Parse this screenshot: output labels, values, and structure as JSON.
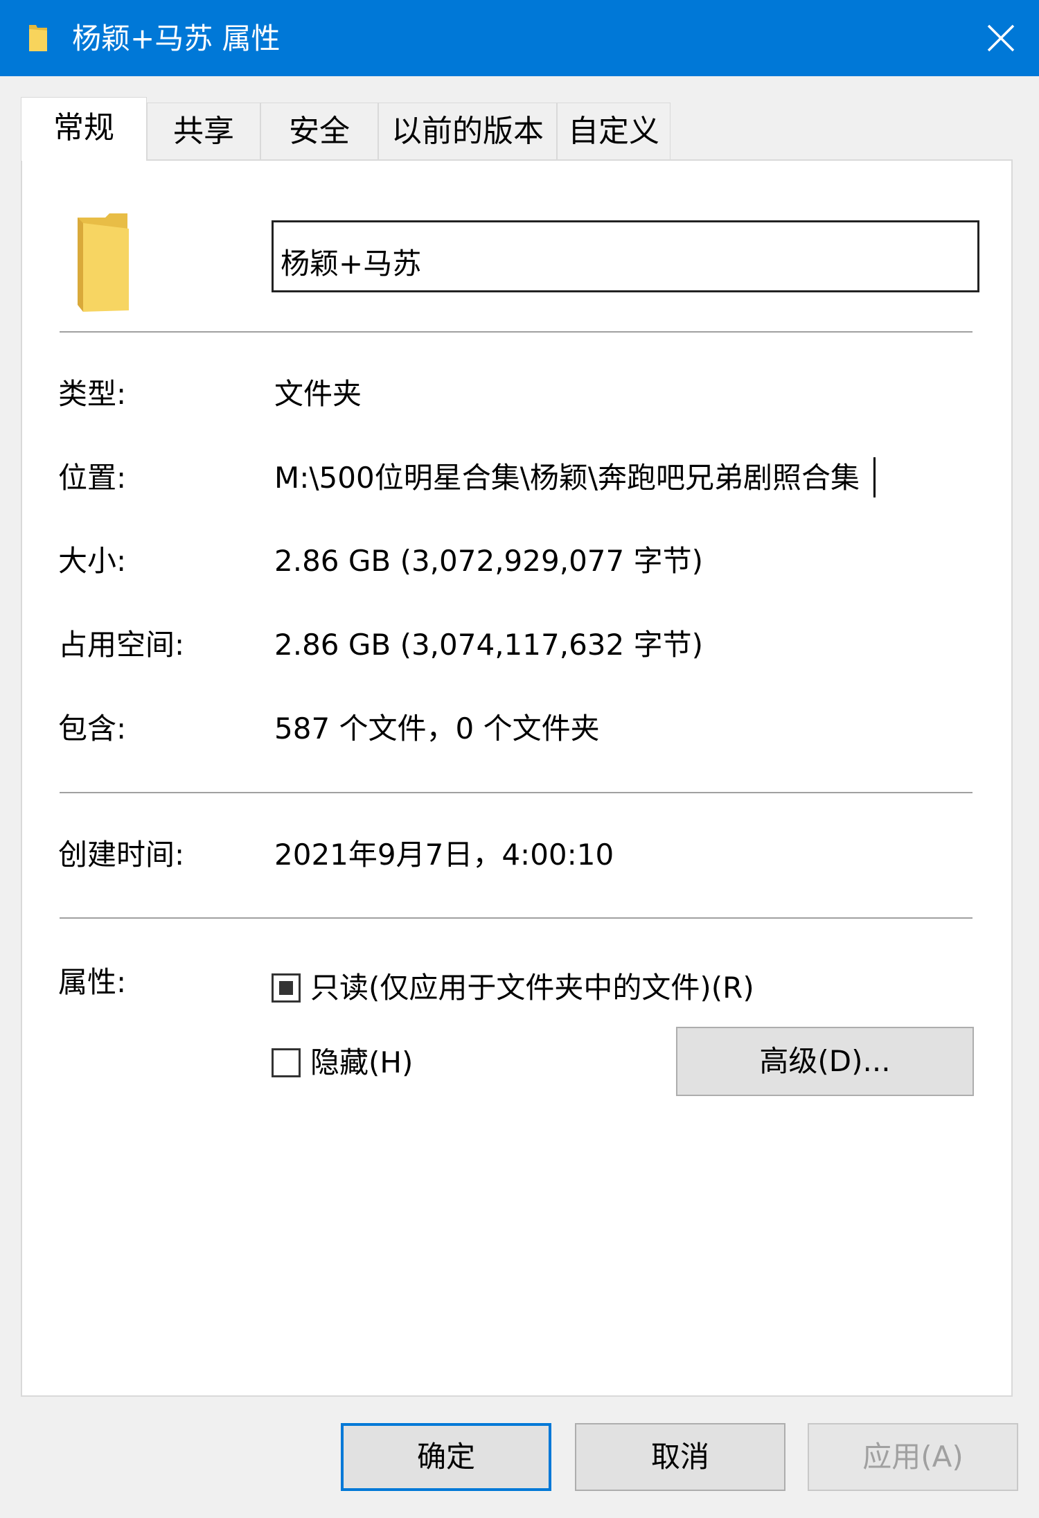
{
  "window": {
    "title": "杨颖+马苏 属性",
    "title_icon": "folder-icon",
    "close_icon": "close-icon"
  },
  "tabs": [
    {
      "label": "常规",
      "active": true
    },
    {
      "label": "共享",
      "active": false
    },
    {
      "label": "安全",
      "active": false
    },
    {
      "label": "以前的版本",
      "active": false
    },
    {
      "label": "自定义",
      "active": false
    }
  ],
  "general": {
    "folder_icon": "folder-icon",
    "name_value": "杨颖+马苏",
    "rows": [
      {
        "label": "类型:",
        "value": "文件夹"
      },
      {
        "label": "位置:",
        "value": "M:\\500位明星合集\\杨颖\\奔跑吧兄弟剧照合集"
      },
      {
        "label": "大小:",
        "value": "2.86 GB (3,072,929,077 字节)"
      },
      {
        "label": "占用空间:",
        "value": "2.86 GB (3,074,117,632 字节)"
      },
      {
        "label": "包含:",
        "value": "587 个文件，0 个文件夹"
      },
      {
        "label": "创建时间:",
        "value": "2021年9月7日，4:00:10"
      }
    ],
    "attributes_label": "属性:",
    "readonly_label": "只读(仅应用于文件夹中的文件)(R)",
    "readonly_state": "indeterminate",
    "hidden_label": "隐藏(H)",
    "hidden_checked": false,
    "advanced_button": "高级(D)..."
  },
  "footer": {
    "ok": "确定",
    "cancel": "取消",
    "apply": "应用(A)"
  },
  "colors": {
    "titlebar": "#0078d7",
    "folder": "#f5d35d",
    "default_button_border": "#0078d7"
  }
}
